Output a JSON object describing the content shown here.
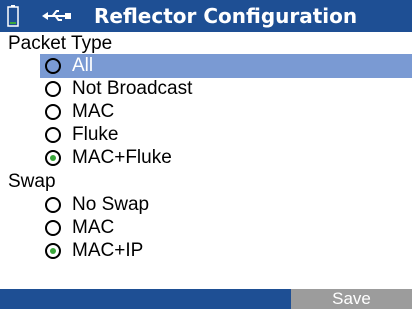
{
  "header": {
    "title": "Reflector Configuration",
    "icons": [
      "battery-icon",
      "usb-icon"
    ],
    "background": "#1e4f94"
  },
  "packet_type": {
    "label": "Packet Type",
    "options": [
      {
        "label": "All",
        "checked": false,
        "highlighted": true
      },
      {
        "label": "Not Broadcast",
        "checked": false
      },
      {
        "label": "MAC",
        "checked": false
      },
      {
        "label": "Fluke",
        "checked": false
      },
      {
        "label": "MAC+Fluke",
        "checked": true
      }
    ]
  },
  "swap": {
    "label": "Swap",
    "options": [
      {
        "label": "No Swap",
        "checked": false
      },
      {
        "label": "MAC",
        "checked": false
      },
      {
        "label": "MAC+IP",
        "checked": true
      }
    ]
  },
  "footer": {
    "save_label": "Save"
  },
  "colors": {
    "highlight": "#7a9ad3",
    "radio_checked": "#3aa63a",
    "button_bg": "#9c9c9c"
  }
}
